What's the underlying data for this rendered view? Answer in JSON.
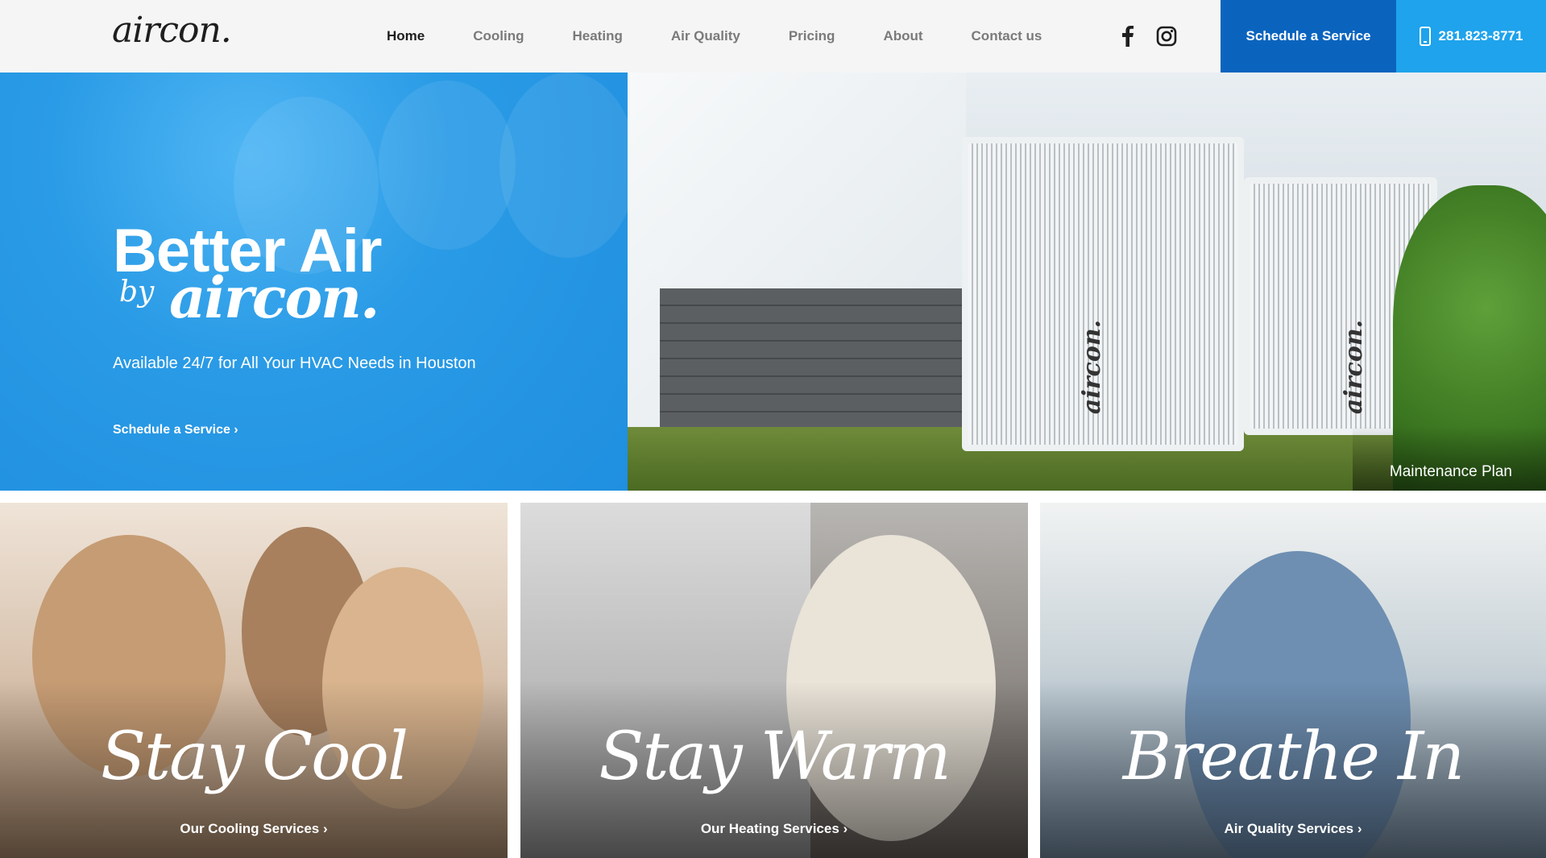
{
  "header": {
    "logo": "aircon.",
    "nav": [
      {
        "label": "Home",
        "active": true
      },
      {
        "label": "Cooling",
        "active": false
      },
      {
        "label": "Heating",
        "active": false
      },
      {
        "label": "Air Quality",
        "active": false
      },
      {
        "label": "Pricing",
        "active": false
      },
      {
        "label": "About",
        "active": false
      },
      {
        "label": "Contact us",
        "active": false
      }
    ],
    "social_icons": [
      "facebook-icon",
      "instagram-icon"
    ],
    "schedule_label": "Schedule a Service",
    "phone": "281.823-8771",
    "colors": {
      "schedule_bg": "#0a64be",
      "phone_bg": "#1ea3ec"
    }
  },
  "hero": {
    "title": "Better Air",
    "by": "by",
    "brand": "aircon.",
    "subtitle": "Available 24/7 for All Your HVAC Needs in Houston",
    "cta": "Schedule a Service ›",
    "accent": "#2a9be6",
    "unit_brand": "aircon.",
    "image_caption": "Maintenance Plan"
  },
  "cards": [
    {
      "title": "Stay Cool",
      "link": "Our Cooling Services ›"
    },
    {
      "title": "Stay Warm",
      "link": "Our Heating Services ›"
    },
    {
      "title": "Breathe In",
      "link": "Air Quality Services ›"
    }
  ]
}
